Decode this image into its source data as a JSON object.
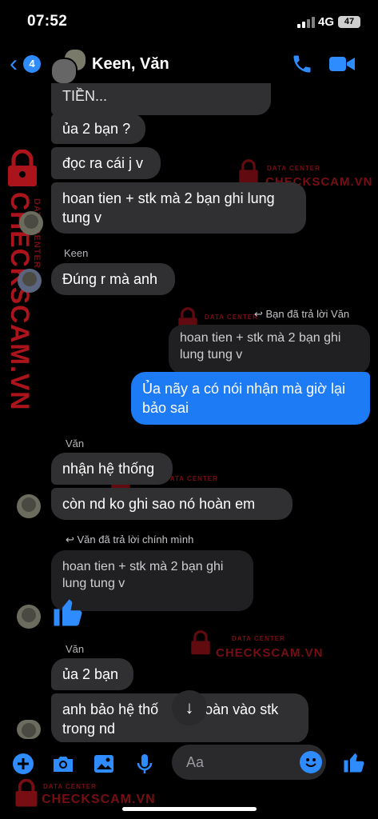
{
  "status": {
    "time": "07:52",
    "network": "4G",
    "battery": "47"
  },
  "header": {
    "back_count": "4",
    "title": "Keen, Văn"
  },
  "messages": {
    "m1": "TIỀN...",
    "m2": "ủa 2 bạn ?",
    "m3": "đọc ra cái j v",
    "m4_l1": "hoan tien + stk mà 2 bạn ghi lung",
    "m4_l2": "tung v",
    "keen_name": "Keen",
    "m5": "Đúng r mà anh",
    "reply_label": "Bạn đã trả lời Văn",
    "quote1_l1": "hoan tien + stk mà 2 bạn ghi",
    "quote1_l2": "lung tung v",
    "me_l1": "Ủa nãy a có nói nhận mà giờ lại",
    "me_l2": "bảo sai",
    "van_name1": "Văn",
    "m6": "nhận hệ thống",
    "m7": "còn nd ko ghi sao nó hoàn em",
    "reply_label2": "Văn đã trả lời chính mình",
    "quote2_l1": "hoan tien + stk mà 2 bạn ghi",
    "quote2_l2": "lung tung v",
    "van_name2": "Văn",
    "m8": "ủa 2 bạn",
    "m9_l1": "anh bảo hệ thố",
    "m9_l1b": "hoàn vào stk",
    "m9_l2": "trong nd"
  },
  "watermark": {
    "data_center": "DATA CENTER",
    "brand": "CHECKSCAM.VN"
  },
  "composer": {
    "placeholder": "Aa"
  },
  "colors": {
    "accent": "#2f8cff",
    "bubble_other": "#303032",
    "bubble_me": "#1d7bf5",
    "watermark": "#d71923"
  }
}
